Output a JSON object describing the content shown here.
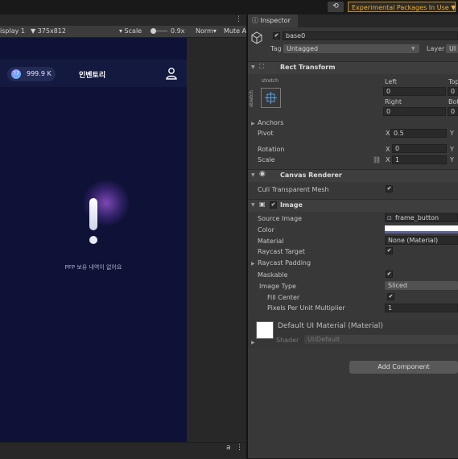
{
  "topbar": {
    "history_icon": "history-icon",
    "experimental_label": "Experimental Packages In Use ▼"
  },
  "game_toolbar": {
    "display": "isplay 1",
    "resolution": "▼  375x812",
    "scale_label": "▾  Scale",
    "scale_value": "0.9x",
    "norm": "Norm▾",
    "mute": "Mute A"
  },
  "app": {
    "currency": "999.9 K",
    "coin_glyph": "77",
    "title": "인벤토리",
    "empty_message": "PFP 보유 내역이 없어요"
  },
  "inspector": {
    "tab_label": "Inspector",
    "object_name": "base0",
    "tag_label": "Tag",
    "tag_value": "Untagged",
    "layer_label": "Layer",
    "layer_value": "UI",
    "rect_transform": {
      "title": "Rect Transform",
      "stretch_top": "stretch",
      "stretch_side": "stretch",
      "left_label": "Left",
      "top_label": "Top",
      "left_value": "0",
      "top_value": "0",
      "right_label": "Right",
      "bottom_label": "Bott",
      "right_value": "0",
      "bottom_value": "0",
      "anchors_label": "Anchors",
      "pivot_label": "Pivot",
      "pivot_x_label": "X",
      "pivot_x": "0.5",
      "pivot_y_label": "Y",
      "rotation_label": "Rotation",
      "rot_x_label": "X",
      "rot_x": "0",
      "rot_y_label": "Y",
      "scale_label": "Scale",
      "scale_x_label": "X",
      "scale_x": "1",
      "scale_y_label": "Y"
    },
    "canvas_renderer": {
      "title": "Canvas Renderer",
      "cull_label": "Culi Transparent Mesh"
    },
    "image": {
      "title": "Image",
      "source_label": "Source Image",
      "source_value": "frame_button",
      "color_label": "Color",
      "color_swatch": "#5f5fa0",
      "material_label": "Material",
      "material_value": "None (Material)",
      "raycast_target_label": "Raycast Target",
      "raycast_padding_label": "Raycast Padding",
      "maskable_label": "Maskable",
      "image_type_label": "Image Type",
      "image_type_value": "Sliced",
      "fill_center_label": "Fill Center",
      "ppu_label": "Pixels Per Unit Multiplier",
      "ppu_value": "1"
    },
    "default_material": {
      "title": "Default UI Material (Material)",
      "shader_label": "Shader",
      "shader_value": "UI/Default"
    },
    "add_component_label": "Add Component",
    "check_glyph": "✔"
  }
}
